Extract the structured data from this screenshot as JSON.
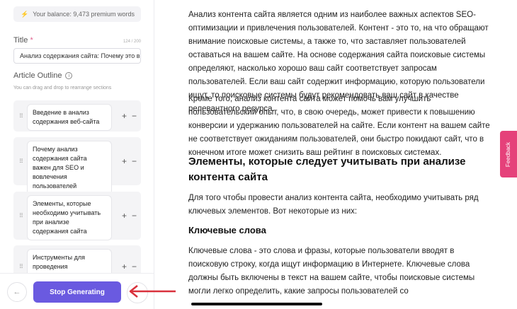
{
  "sidebar": {
    "balance": "Your balance: 9,473 premium words",
    "title_label": "Title",
    "title_required": "*",
    "title_counter": "124 / 200",
    "title_value": "Анализ содержания сайта: Почему это в",
    "outline_label": "Article Outline",
    "outline_hint": "You can drag and drop to rearrange sections",
    "sections": [
      {
        "label": "Введение в анализ содержания веб-сайта"
      },
      {
        "label": "Почему анализ содержания сайта важен для SEO и вовлечения пользователей"
      },
      {
        "label": "Элементы, которые необходимо учитывать при анализе содержания сайта"
      },
      {
        "label": "Инструменты для проведения тщательного"
      }
    ],
    "stop_label": "Stop Generating"
  },
  "content": {
    "p1": "Анализ контента сайта является одним из наиболее важных аспектов SEO-оптимизации и привлечения пользователей. Контент - это то, на что обращают внимание поисковые системы, а также то, что заставляет пользователей оставаться на вашем сайте. На основе содержания сайта поисковые системы определяют, насколько хорошо ваш сайт соответствует запросам пользователей. Если ваш сайт содержит информацию, которую пользователи ищут, то поисковые системы будут рекомендовать ваш сайт в качестве релевантного ресурса.",
    "p2": "Кроме того, анализ контента сайта может помочь вам улучшить пользовательский опыт, что, в свою очередь, может привести к повышению конверсии и удержанию пользователей на сайте. Если контент на вашем сайте не соответствует ожиданиям пользователей, они быстро покидают сайт, что в конечном итоге может снизить ваш рейтинг в поисковых системах.",
    "h2": "Элементы, которые следует учитывать при анализе контента сайта",
    "p3": "Для того чтобы провести анализ контента сайта, необходимо учитывать ряд ключевых элементов. Вот некоторые из них:",
    "h3": "Ключевые слова",
    "p4": "Ключевые слова - это слова и фразы, которые пользователи вводят в поисковую строку, когда ищут информацию в Интернете. Ключевые слова должны быть включены в текст на вашем сайте, чтобы поисковые системы могли легко определить, какие запросы пользователей со"
  },
  "feedback_label": "Feedback",
  "icons": {
    "bolt": "bolt-icon",
    "info": "info-icon",
    "drag": "drag-handle-icon",
    "plus": "plus-icon",
    "minus": "minus-icon",
    "back": "arrow-left-icon"
  },
  "colors": {
    "accent": "#6a5ae0",
    "feedback": "#e5417a",
    "annotation_arrow": "#d9313c"
  }
}
